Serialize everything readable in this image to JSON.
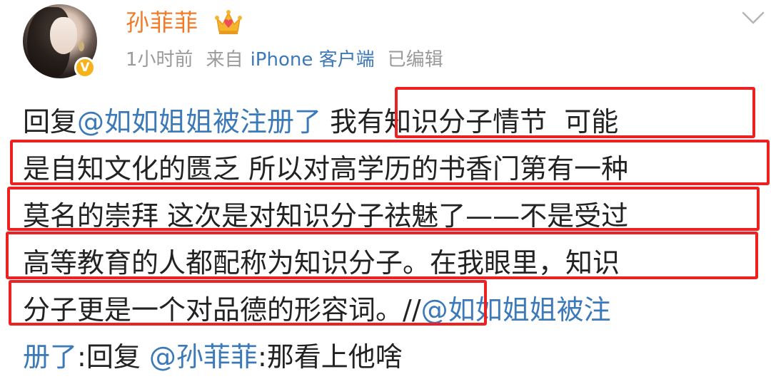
{
  "user": {
    "name": "孙菲菲",
    "verified_badge": "V",
    "crown_icon": "crown-icon"
  },
  "meta": {
    "time": "1小时前",
    "source_prefix": "来自",
    "client": "iPhone 客户端",
    "edited": "已编辑"
  },
  "post": {
    "line1": {
      "prefix": "回复",
      "mention": "@如如姐姐被注册了",
      "text": "我有知识分子情节  可能"
    },
    "line2": "是自知文化的匮乏 所以对高学历的书香门第有一种",
    "line3": "莫名的崇拜 这次是对知识分子祛魅了——不是受过",
    "line4": "高等教育的人都配称为知识分子。在我眼里，知识",
    "line5": {
      "text": "分子更是一个对品德的形容词。",
      "sep": "//",
      "mention": "@如如姐姐被注"
    },
    "line6": {
      "mention": "册了",
      "text1": ":回复",
      "mention2": "@孙菲菲",
      "text2": ":那看上他啥"
    }
  },
  "colors": {
    "username": "#ef7c2a",
    "mention": "#3b79b9",
    "meta": "#9a9a9a",
    "highlight_box": "#ec2222",
    "badge": "#f6b21a"
  }
}
